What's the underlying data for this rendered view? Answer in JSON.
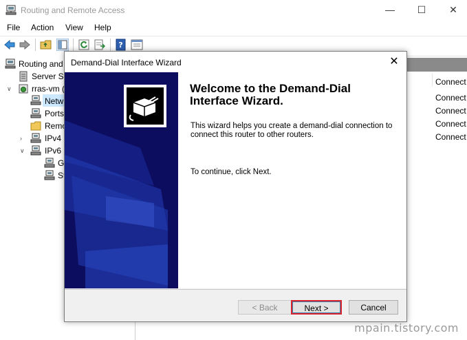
{
  "window": {
    "title": "Routing and Remote Access",
    "minimize_glyph": "—",
    "maximize_glyph": "☐",
    "close_glyph": "✕"
  },
  "menu": [
    "File",
    "Action",
    "View",
    "Help"
  ],
  "toolbar": {
    "icons": [
      "back-arrow-icon",
      "forward-arrow-icon",
      "up-folder-icon",
      "show-hide-tree-icon",
      "refresh-icon",
      "export-list-icon",
      "help-icon",
      "properties-icon"
    ]
  },
  "tree": {
    "root": "Routing and",
    "server_status": "Server St",
    "server": "rras-vm (",
    "children": [
      "Netw",
      "Ports",
      "Remo",
      "IPv4",
      "IPv6"
    ],
    "ipv6_children": [
      "G",
      "St"
    ]
  },
  "results": {
    "status_column": [
      "Connect",
      "Connect",
      "Connect",
      "Connect",
      "Connect"
    ]
  },
  "wizard": {
    "title": "Demand-Dial Interface Wizard",
    "heading": "Welcome to the Demand-Dial Interface Wizard.",
    "description": "This wizard helps you create a demand-dial connection to connect this router to other routers.",
    "continue_text": "To continue, click Next.",
    "back_label": "< Back",
    "next_label": "Next >",
    "cancel_label": "Cancel",
    "close_glyph": "✕"
  },
  "watermark": "mpain.tistory.com",
  "colors": {
    "banner": "#0d0d60",
    "highlight_border": "#d8242c",
    "results_header": "#8a8a8a"
  }
}
